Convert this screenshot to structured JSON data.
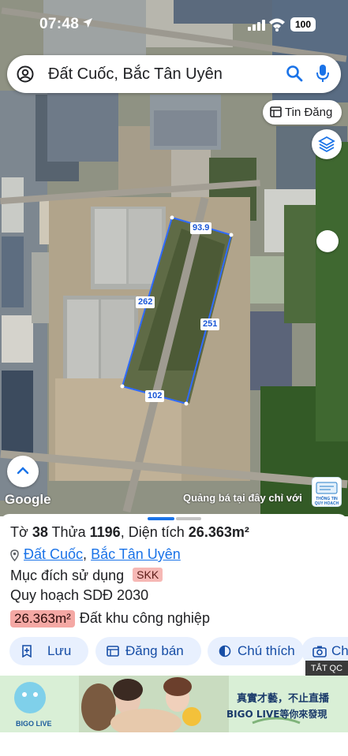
{
  "status_bar": {
    "time": "07:48",
    "battery": "100"
  },
  "search": {
    "query": "Đất Cuốc, Bắc Tân Uyên"
  },
  "map": {
    "tin_dang_label": "Tin Đăng",
    "segment_labels": [
      "93.9",
      "262",
      "251",
      "102"
    ],
    "watermark": "Google",
    "promo_text": "Quảng bá tại đây chỉ với",
    "plan_logo_text": "THÔNG TIN QUY HOẠCH"
  },
  "parcel": {
    "sheet_label": "Tờ",
    "sheet_number": "38",
    "lot_label": "Thửa",
    "lot_number": "1196",
    "area_label": "Diện tích",
    "area_value": "26.363m²",
    "location_ward": "Đất Cuốc",
    "location_sep": ",",
    "location_district": "Bắc Tân Uyên",
    "purpose_label": "Mục đích sử dụng",
    "purpose_code": "SKK",
    "planning_label": "Quy hoạch SDĐ 2030",
    "planning_area": "26.363m²",
    "planning_type": "Đất khu công nghiệp"
  },
  "actions": [
    {
      "label": "Lưu",
      "icon": "bookmark-plus-icon"
    },
    {
      "label": "Đăng bán",
      "icon": "listing-icon"
    },
    {
      "label": "Chú thích",
      "icon": "legend-icon"
    },
    {
      "label": "Ch",
      "icon": "camera-icon"
    }
  ],
  "ad": {
    "close_label": "TẮT QC",
    "brand": "BIGO LIVE",
    "slogan": "真實才藝，不止直播",
    "brand_line": "BIGO LIVE等你來發現"
  },
  "colors": {
    "accent": "#1a73e8",
    "chip_bg": "#e8f0fe",
    "tag_red": "#f6b8b5",
    "parcel_outline": "#2f6bff"
  }
}
